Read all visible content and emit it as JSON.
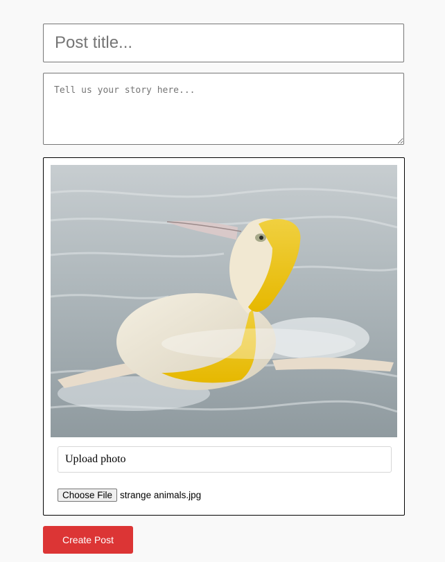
{
  "form": {
    "title_placeholder": "Post title...",
    "title_value": "",
    "story_placeholder": "Tell us your story here...",
    "story_value": ""
  },
  "upload": {
    "image_subject": "yellow-and-white penguin swimming in water",
    "label": "Upload photo",
    "choose_file_label": "Choose File",
    "selected_file": "strange animals.jpg"
  },
  "actions": {
    "create_label": "Create Post"
  },
  "colors": {
    "page_background": "#f9f9f9",
    "create_button": "#dc3535"
  }
}
